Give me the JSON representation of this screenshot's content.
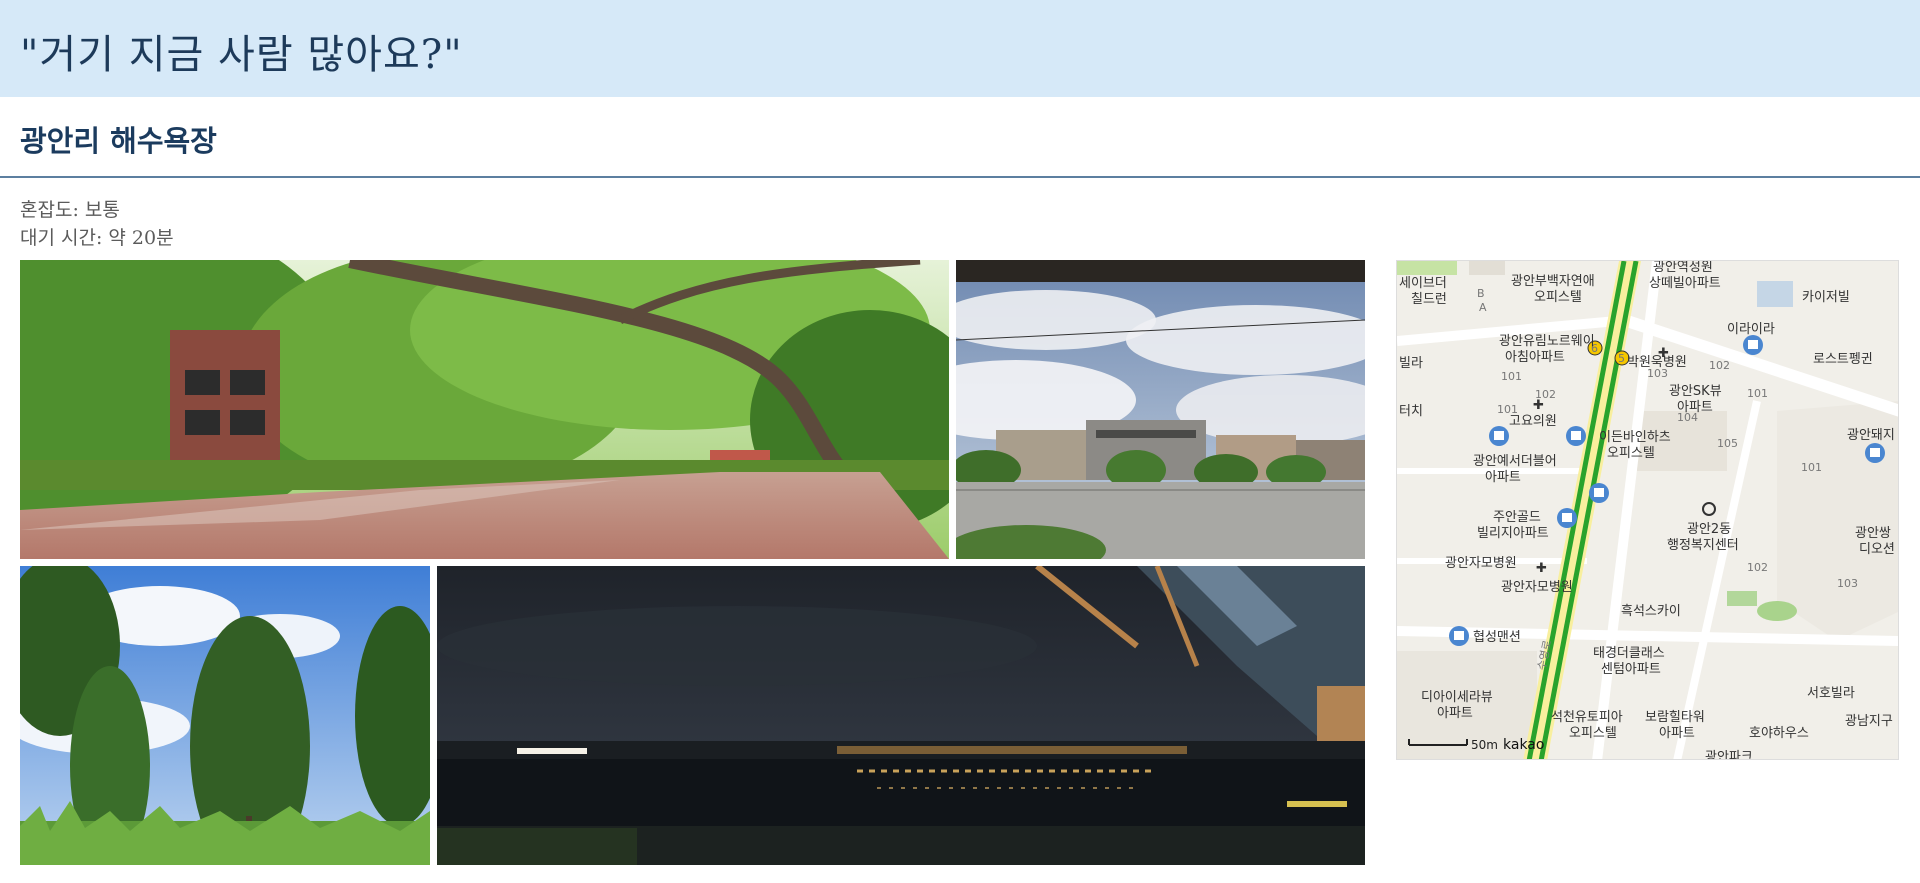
{
  "header": {
    "title": "\"거기 지금 사람 많아요?\""
  },
  "place": {
    "name": "광안리 해수욕장",
    "congestion": "혼잡도: 보통",
    "wait_time": "대기 시간: 약 20분"
  },
  "photos": [
    {
      "subject": "tree-lined walkway"
    },
    {
      "subject": "sky over buildings"
    },
    {
      "subject": "poplar trees"
    },
    {
      "subject": "night river view"
    }
  ],
  "map": {
    "labels": {
      "l1": "광안역성원",
      "l2": "상떼빌아파트",
      "l3": "세이브더",
      "l4": "칠드런",
      "l5": "광안부백자연애",
      "l6": "오피스텔",
      "l7": "카이저빌",
      "l8": "이라이라",
      "l9": "광안유림노르웨이",
      "l10": "아침아파트",
      "l11": "박원욱병원",
      "l12": "로스트펭귄",
      "l13": "빌라",
      "l14": "광안SK뷰",
      "l15": "아파트",
      "l16": "터치",
      "l17": "고요의원",
      "l18": "이든바인하츠",
      "l19": "오피스텔",
      "l20": "광안돼지",
      "l21": "광안예서더블어",
      "l22": "아파트",
      "l23": "광안2동",
      "l24": "행정복지센터",
      "l25": "주안골드",
      "l26": "빌리지아파트",
      "l27": "광안쌍",
      "l28": "디오션",
      "l29": "광안자모병원",
      "l30": "광안자모병원",
      "l31": "흑석스카이",
      "l32": "협성맨션",
      "l33": "태경더클래스",
      "l34": "센텀아파트",
      "l35": "디아이세라뷰",
      "l36": "아파트",
      "l37": "석천유토피아",
      "l38": "오피스텔",
      "l39": "보람힐타워",
      "l40": "아파트",
      "l41": "서호빌라",
      "l42": "호야하우스",
      "l43": "광남지구",
      "l44": "광안파크",
      "n1": "101",
      "n2": "102",
      "n3": "103",
      "n4": "104",
      "n5": "105",
      "n6": "101",
      "n7": "102",
      "n8": "103",
      "n9": "101",
      "n10": "102",
      "n11": "101",
      "n12": "B",
      "n13": "A",
      "station_6": "6",
      "station_5": "5",
      "road": "수영로"
    },
    "scale_label": "50m",
    "logo": "kakao"
  }
}
